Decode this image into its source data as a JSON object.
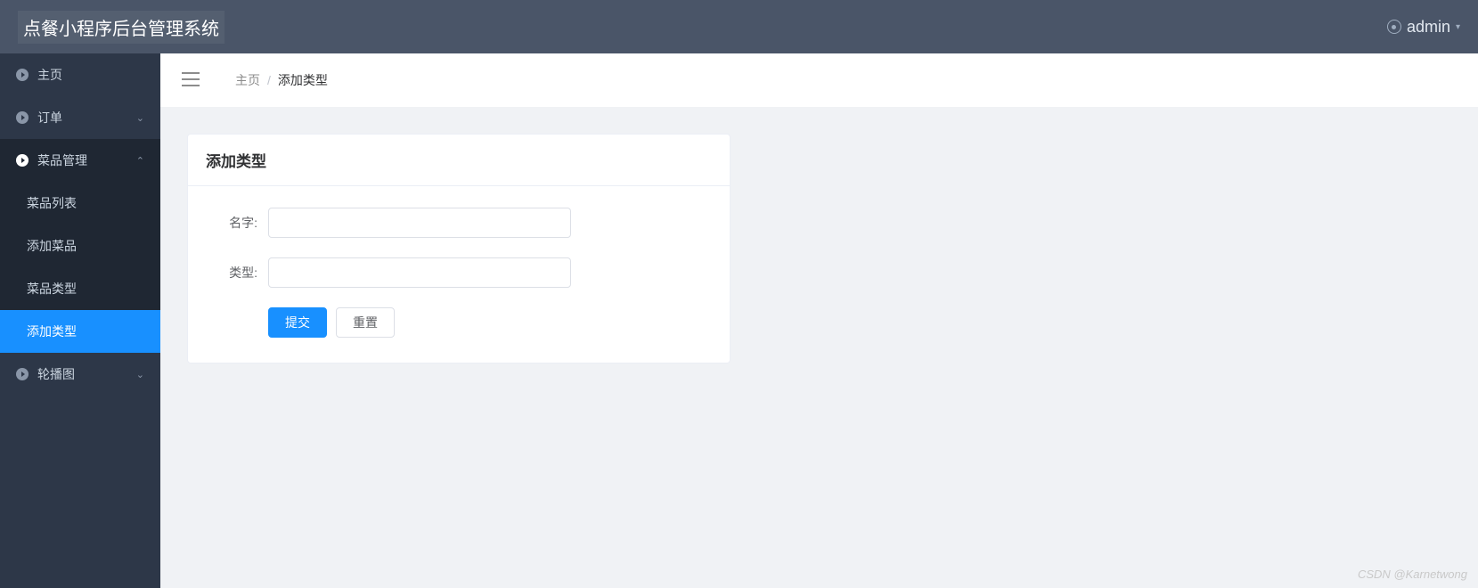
{
  "header": {
    "title": "点餐小程序后台管理系统",
    "user": "admin"
  },
  "sidebar": {
    "home": "主页",
    "orders": "订单",
    "dish_mgmt": "菜品管理",
    "dish_list": "菜品列表",
    "add_dish": "添加菜品",
    "dish_type": "菜品类型",
    "add_type": "添加类型",
    "carousel": "轮播图"
  },
  "breadcrumb": {
    "home": "主页",
    "current": "添加类型"
  },
  "form": {
    "title": "添加类型",
    "name_label": "名字:",
    "name_value": "",
    "type_label": "类型:",
    "type_value": "",
    "submit": "提交",
    "reset": "重置"
  },
  "watermark": "CSDN @Karnetwong"
}
